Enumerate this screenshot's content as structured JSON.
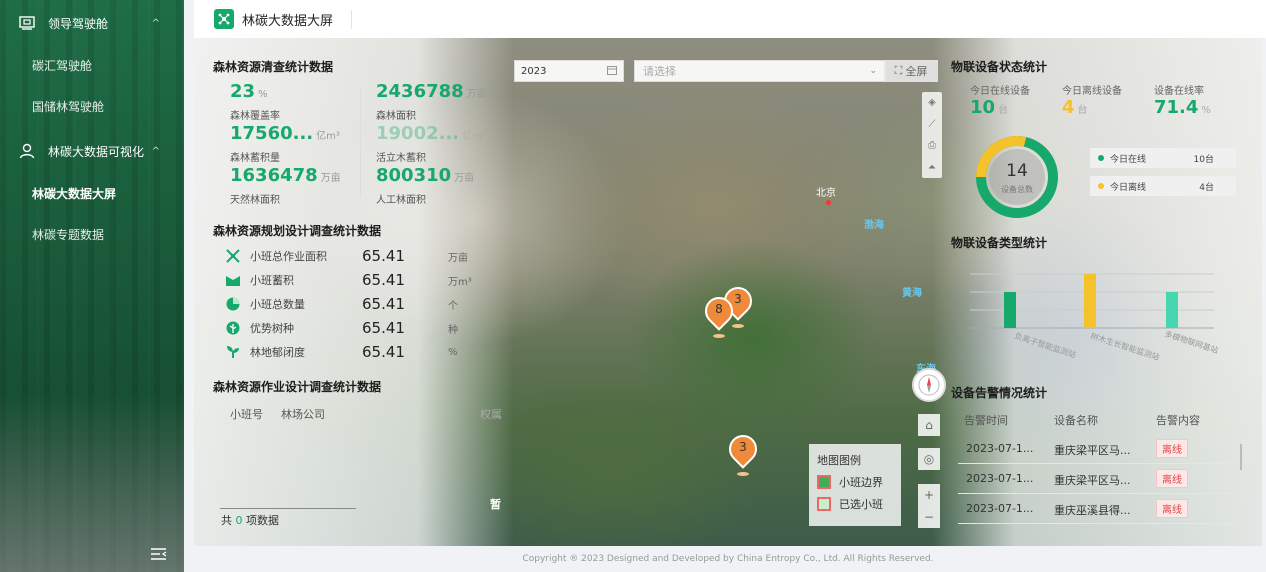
{
  "sidebar": {
    "groups": [
      {
        "label": "领导驾驶舱",
        "items": [
          "碳汇驾驶舱",
          "国储林驾驶舱"
        ]
      },
      {
        "label": "林碳大数据可视化",
        "items": [
          "林碳大数据大屏",
          "林碳专题数据"
        ]
      }
    ],
    "active_item": "林碳大数据大屏"
  },
  "header": {
    "title": "林碳大数据大屏"
  },
  "forest_stats": {
    "title": "森林资源清查统计数据",
    "kpis": [
      {
        "value": "23",
        "unit": "%",
        "label": "森林覆盖率"
      },
      {
        "value": "2436788",
        "unit": "万亩",
        "label": "森林面积"
      },
      {
        "value": "17560...",
        "unit": "亿m³",
        "label": "森林蓄积量"
      },
      {
        "value": "19002...",
        "unit": "亿m³",
        "label": "活立木蓄积"
      },
      {
        "value": "1636478",
        "unit": "万亩",
        "label": "天然林面积"
      },
      {
        "value": "800310",
        "unit": "万亩",
        "label": "人工林面积"
      }
    ]
  },
  "plan_stats": {
    "title": "森林资源规划设计调查统计数据",
    "rows": [
      {
        "icon": "area-icon",
        "label": "小班总作业面积",
        "value": "65.41",
        "unit": "万亩"
      },
      {
        "icon": "volume-icon",
        "label": "小班蓄积",
        "value": "65.41",
        "unit": "万m³"
      },
      {
        "icon": "pie-icon",
        "label": "小班总数量",
        "value": "65.41",
        "unit": "个"
      },
      {
        "icon": "tree-icon",
        "label": "优势树种",
        "value": "65.41",
        "unit": "种"
      },
      {
        "icon": "sprout-icon",
        "label": "林地郁闭度",
        "value": "65.41",
        "unit": "%"
      }
    ]
  },
  "work_stats": {
    "title": "森林资源作业设计调查统计数据",
    "columns": [
      "小班号",
      "林场公司"
    ],
    "extra_column": "权属",
    "total_prefix": "共",
    "total_count": "0",
    "total_suffix": "项数据",
    "empty_text": "暂"
  },
  "map": {
    "year": "2023",
    "select_placeholder": "请选择",
    "fullscreen_label": "全屏",
    "labels": {
      "beijing": "北京",
      "bohai": "渤海",
      "huanghai": "黄海",
      "donghai": "东海"
    },
    "markers": [
      "8",
      "3",
      "3"
    ],
    "legend": {
      "title": "地图图例",
      "items": [
        "小班边界",
        "已选小班"
      ]
    }
  },
  "iot_status": {
    "title": "物联设备状态统计",
    "online_label": "今日在线设备",
    "online_value": "10",
    "online_unit": "台",
    "offline_label": "今日离线设备",
    "offline_value": "4",
    "offline_unit": "台",
    "rate_label": "设备在线率",
    "rate_value": "71.4",
    "rate_unit": "%",
    "total": "14",
    "total_label": "设备总数",
    "legend": [
      {
        "label": "今日在线",
        "count": "10台",
        "color": "#17a86b"
      },
      {
        "label": "今日离线",
        "count": "4台",
        "color": "#f5c22b"
      }
    ]
  },
  "iot_type": {
    "title": "物联设备类型统计",
    "categories": [
      "负离子智能监测站",
      "树木生长智能监测站",
      "多模物联网基站"
    ]
  },
  "alarms": {
    "title": "设备告警情况统计",
    "columns": [
      "告警时间",
      "设备名称",
      "告警内容"
    ],
    "rows": [
      {
        "time": "2023-07-1...",
        "device": "重庆梁平区马...",
        "content": "离线"
      },
      {
        "time": "2023-07-1...",
        "device": "重庆梁平区马...",
        "content": "离线"
      },
      {
        "time": "2023-07-1...",
        "device": "重庆巫溪县得...",
        "content": "离线"
      }
    ]
  },
  "footer": "Copyright ® 2023 Designed and Developed by China Entropy Co., Ltd. All Rights Reserved.",
  "colors": {
    "brand": "#17a86b",
    "accent": "#f5c22b",
    "bar_teal": "#48d6b0",
    "marker": "#ef8a3a"
  }
}
